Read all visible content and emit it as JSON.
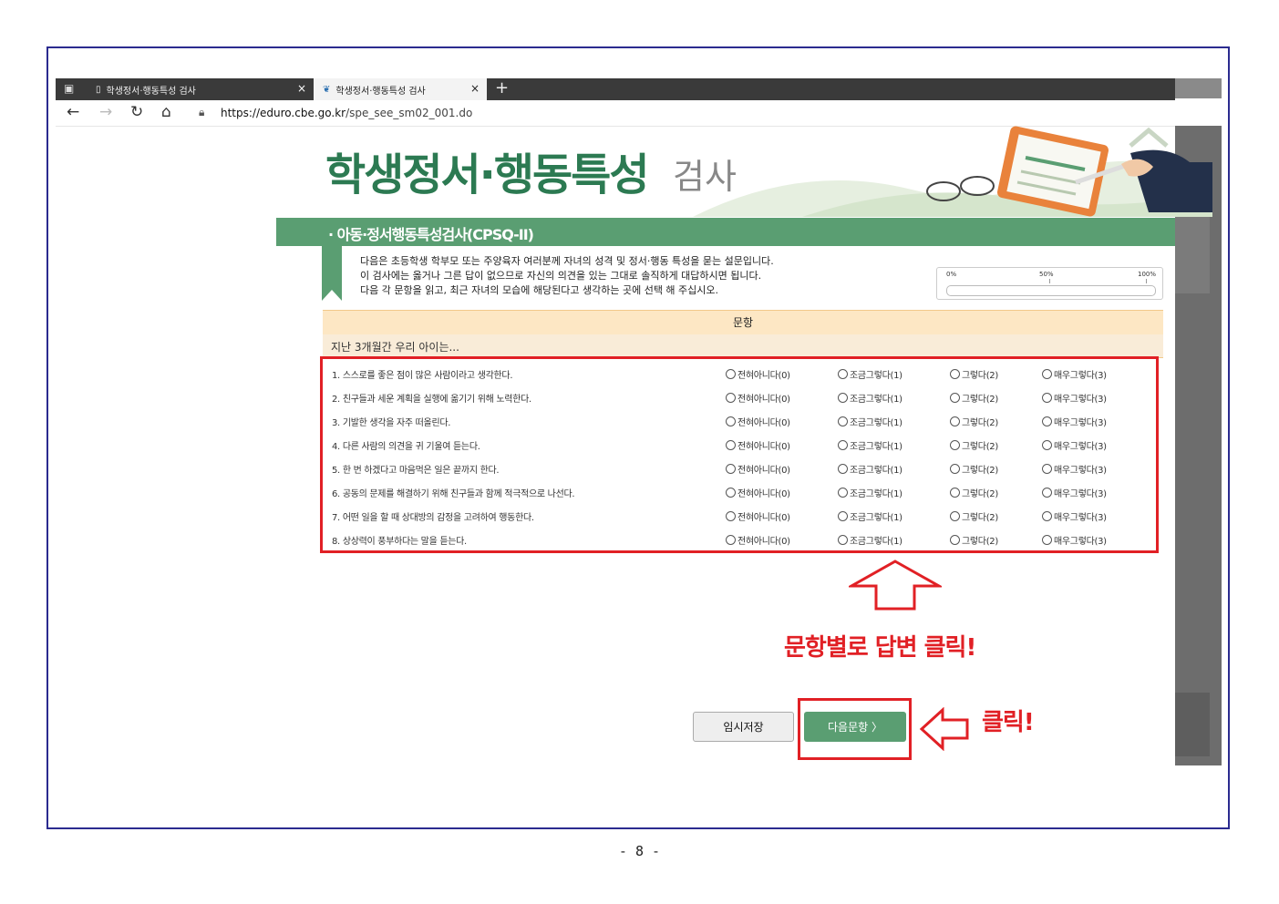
{
  "browser": {
    "tabs": [
      {
        "title": "학생정서·행동특성 검사",
        "active": false
      },
      {
        "title": "학생정서·행동특성 검사",
        "active": true
      }
    ],
    "close_glyph": "×",
    "new_tab_glyph": "+",
    "url_host": "https://eduro.cbe.go.kr",
    "url_path": "/spe_see_sm02_001.do"
  },
  "page": {
    "title": "학생정서·행동특성",
    "title_suffix": "검사",
    "section_title": "· 아동·정서행동특성검사(CPSQ-II)",
    "intro_lines": [
      "다음은 초등학생 학부모 또는 주양육자 여러분께 자녀의 성격 및 정서·행동 특성을 묻는 설문입니다.",
      "이 검사에는 옳거나 그른 답이 없으므로 자신의 의견을 있는 그대로 솔직하게 대답하시면 됩니다.",
      "다음 각 문항을 읽고, 최근 자녀의 모습에 해당된다고 생각하는 곳에 선택 해 주십시오."
    ],
    "progress": {
      "labels": [
        "0%",
        "50%",
        "100%"
      ],
      "value": 0
    },
    "table_header": "문항",
    "table_subheader": "지난 3개월간 우리 아이는...",
    "options": [
      "전혀아니다(0)",
      "조금그렇다(1)",
      "그렇다(2)",
      "매우그렇다(3)"
    ],
    "questions": [
      "1. 스스로를 좋은 점이 많은 사람이라고 생각한다.",
      "2. 친구들과 세운 계획을 실행에 옮기기 위해 노력한다.",
      "3. 기발한 생각을 자주 떠올린다.",
      "4. 다른 사람의 의견을 귀 기울여 듣는다.",
      "5. 한 번 하겠다고 마음먹은 일은 끝까지 한다.",
      "6. 공동의 문제를 해결하기 위해 친구들과 함께 적극적으로 나선다.",
      "7. 어떤 일을 할 때 상대방의 감정을 고려하여 행동한다.",
      "8. 상상력이 풍부하다는 말을 듣는다."
    ],
    "save_button": "임시저장",
    "next_button": "다음문항 〉"
  },
  "annotations": {
    "answer_instruction": "문항별로 답변 클릭!",
    "click_instruction": "클릭!",
    "highlight_color": "#e12025"
  },
  "page_number": "- 8 -",
  "colors": {
    "brand_green": "#5a9e72",
    "title_green": "#2c7a52",
    "frame_blue": "#2b2b8f"
  }
}
